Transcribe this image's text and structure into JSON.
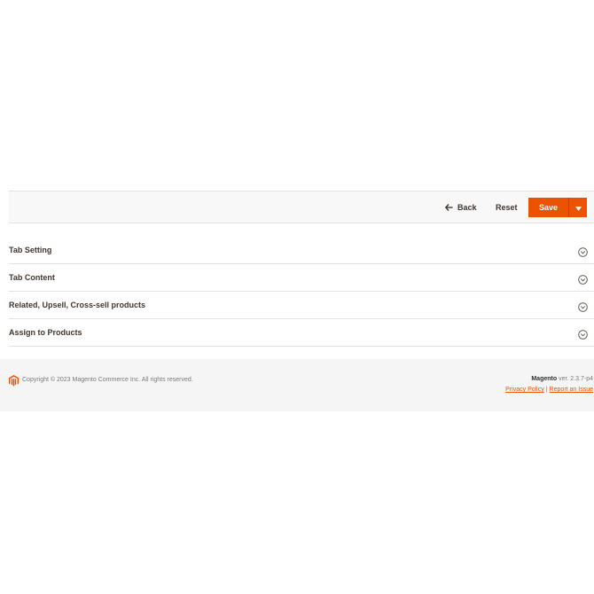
{
  "toolbar": {
    "back_label": "Back",
    "reset_label": "Reset",
    "save_label": "Save"
  },
  "sections": [
    {
      "title": "Tab Setting"
    },
    {
      "title": "Tab Content"
    },
    {
      "title": "Related, Upsell, Cross-sell products"
    },
    {
      "title": "Assign to Products"
    }
  ],
  "footer": {
    "copyright": "Copyright © 2023 Magento Commerce Inc. All rights reserved.",
    "brand": "Magento",
    "version": "ver. 2.3.7-p4",
    "privacy_link": "Privacy Policy",
    "separator": "|",
    "report_link": "Report an Issue"
  },
  "colors": {
    "accent": "#eb5202",
    "toolbar_bg": "#f8f8f8",
    "footer_bg": "#f5f5f5"
  },
  "icons": {
    "back": "arrow-left-icon",
    "save_toggle": "caret-down-icon",
    "section_toggle": "chevron-down-circle-icon",
    "logo": "magento-logo-icon"
  }
}
